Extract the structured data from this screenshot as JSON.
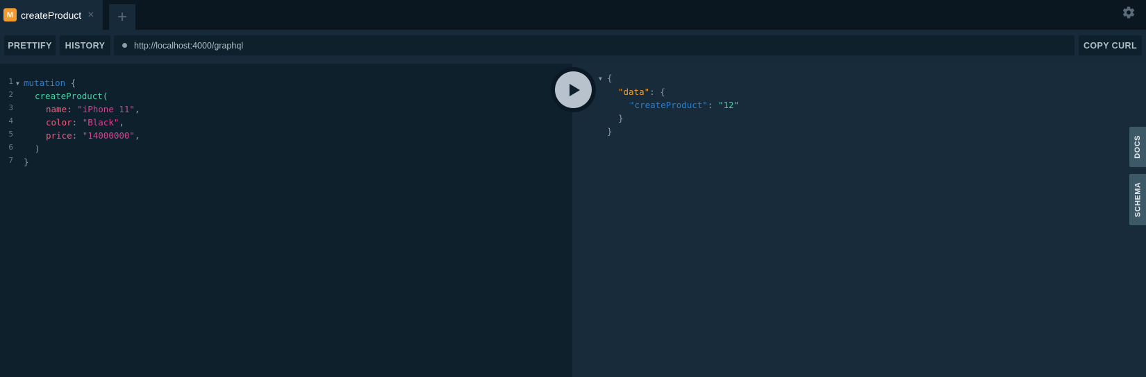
{
  "tabs": [
    {
      "badge": "M",
      "title": "createProduct",
      "close": "×"
    }
  ],
  "add_tab_label": "+",
  "toolbar": {
    "prettify": "PRETTIFY",
    "history": "HISTORY",
    "url": "http://localhost:4000/graphql",
    "copy_curl": "COPY CURL"
  },
  "editor": {
    "line_numbers": [
      "1",
      "2",
      "3",
      "4",
      "5",
      "6",
      "7"
    ],
    "lines": {
      "l1_keyword": "mutation",
      "l1_brace": "{",
      "l2_field": "createProduct",
      "l2_paren": "(",
      "l3_arg": "name",
      "l3_value": "\"iPhone 11\"",
      "l4_arg": "color",
      "l4_value": "\"Black\"",
      "l5_arg": "price",
      "l5_value": "\"14000000\"",
      "l6_paren": ")",
      "l7_brace": "}"
    }
  },
  "result": {
    "open_brace": "{",
    "data_key": "\"data\"",
    "data_open": "{",
    "field_key": "\"createProduct\"",
    "field_value": "\"12\"",
    "data_close": "}",
    "close_brace": "}"
  },
  "side_tabs": {
    "docs": "DOCS",
    "schema": "SCHEMA"
  },
  "colors": {
    "background": "#0f202d",
    "result_background": "#172b3a",
    "badge": "#f19b31",
    "keyword": "#2a7ed3",
    "field": "#42d3a5",
    "argument": "#f25c7d",
    "string": "#d64292"
  },
  "icons": {
    "settings": "gear-icon",
    "run": "play-icon",
    "fold": "triangle-down-icon"
  }
}
